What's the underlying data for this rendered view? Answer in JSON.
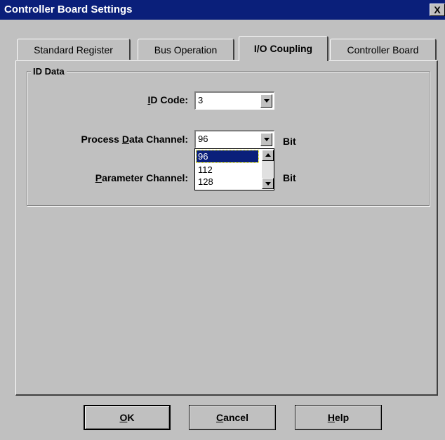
{
  "window": {
    "title": "Controller Board Settings",
    "close_label": "X"
  },
  "tabs": [
    {
      "label": "Standard Register",
      "active": false
    },
    {
      "label": "Bus Operation",
      "active": false
    },
    {
      "label": "I/O Coupling",
      "active": true
    },
    {
      "label": "Controller Board",
      "active": false
    }
  ],
  "group": {
    "title": "ID Data"
  },
  "fields": {
    "id_code": {
      "label_pre": "",
      "label_mnemonic": "I",
      "label_post": "D Code:",
      "value": "3"
    },
    "process_data_channel": {
      "label_pre": "Process ",
      "label_mnemonic": "D",
      "label_post": "ata Channel:",
      "value": "96",
      "unit": "Bit"
    },
    "parameter_channel": {
      "label_pre": "",
      "label_mnemonic": "P",
      "label_post": "arameter Channel:",
      "unit": "Bit"
    }
  },
  "dropdown": {
    "options": [
      "96",
      "112",
      "128"
    ],
    "selected": "96"
  },
  "buttons": {
    "ok": {
      "mnemonic": "O",
      "rest": "K"
    },
    "cancel": {
      "mnemonic": "C",
      "rest": "ancel"
    },
    "help": {
      "mnemonic": "H",
      "rest": "elp"
    }
  },
  "colors": {
    "titlebar": "#0a1f7a",
    "face": "#c0c0c0",
    "selection": "#0a1f7a"
  }
}
